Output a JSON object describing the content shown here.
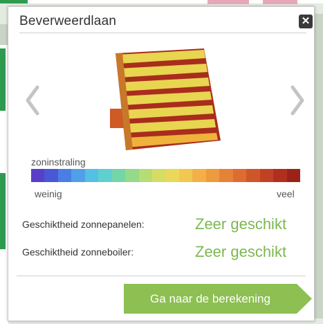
{
  "popup": {
    "title": "Beverweerdlaan",
    "close_icon": "close-icon",
    "prev_icon": "chevron-left-icon",
    "next_icon": "chevron-right-icon"
  },
  "legend": {
    "label": "zoninstraling",
    "low": "weinig",
    "high": "veel",
    "colors": [
      "#5a3ec8",
      "#4a57d6",
      "#4b7ee0",
      "#4fa0e6",
      "#56bfe6",
      "#5fd0cf",
      "#74d6a8",
      "#95d98a",
      "#b7dc73",
      "#d6dd63",
      "#ead85a",
      "#f2c84f",
      "#f2b046",
      "#ee9a3f",
      "#e68238",
      "#dc6c32",
      "#cf562b",
      "#c14125",
      "#b02f1f",
      "#9c2219"
    ]
  },
  "suitability": [
    {
      "label": "Geschiktheid zonnepanelen:",
      "value": "Zeer geschikt"
    },
    {
      "label": "Geschiktheid zonneboiler:",
      "value": "Zeer geschikt"
    }
  ],
  "cta": {
    "label": "Ga naar de berekening",
    "color": "#8dbf52"
  }
}
